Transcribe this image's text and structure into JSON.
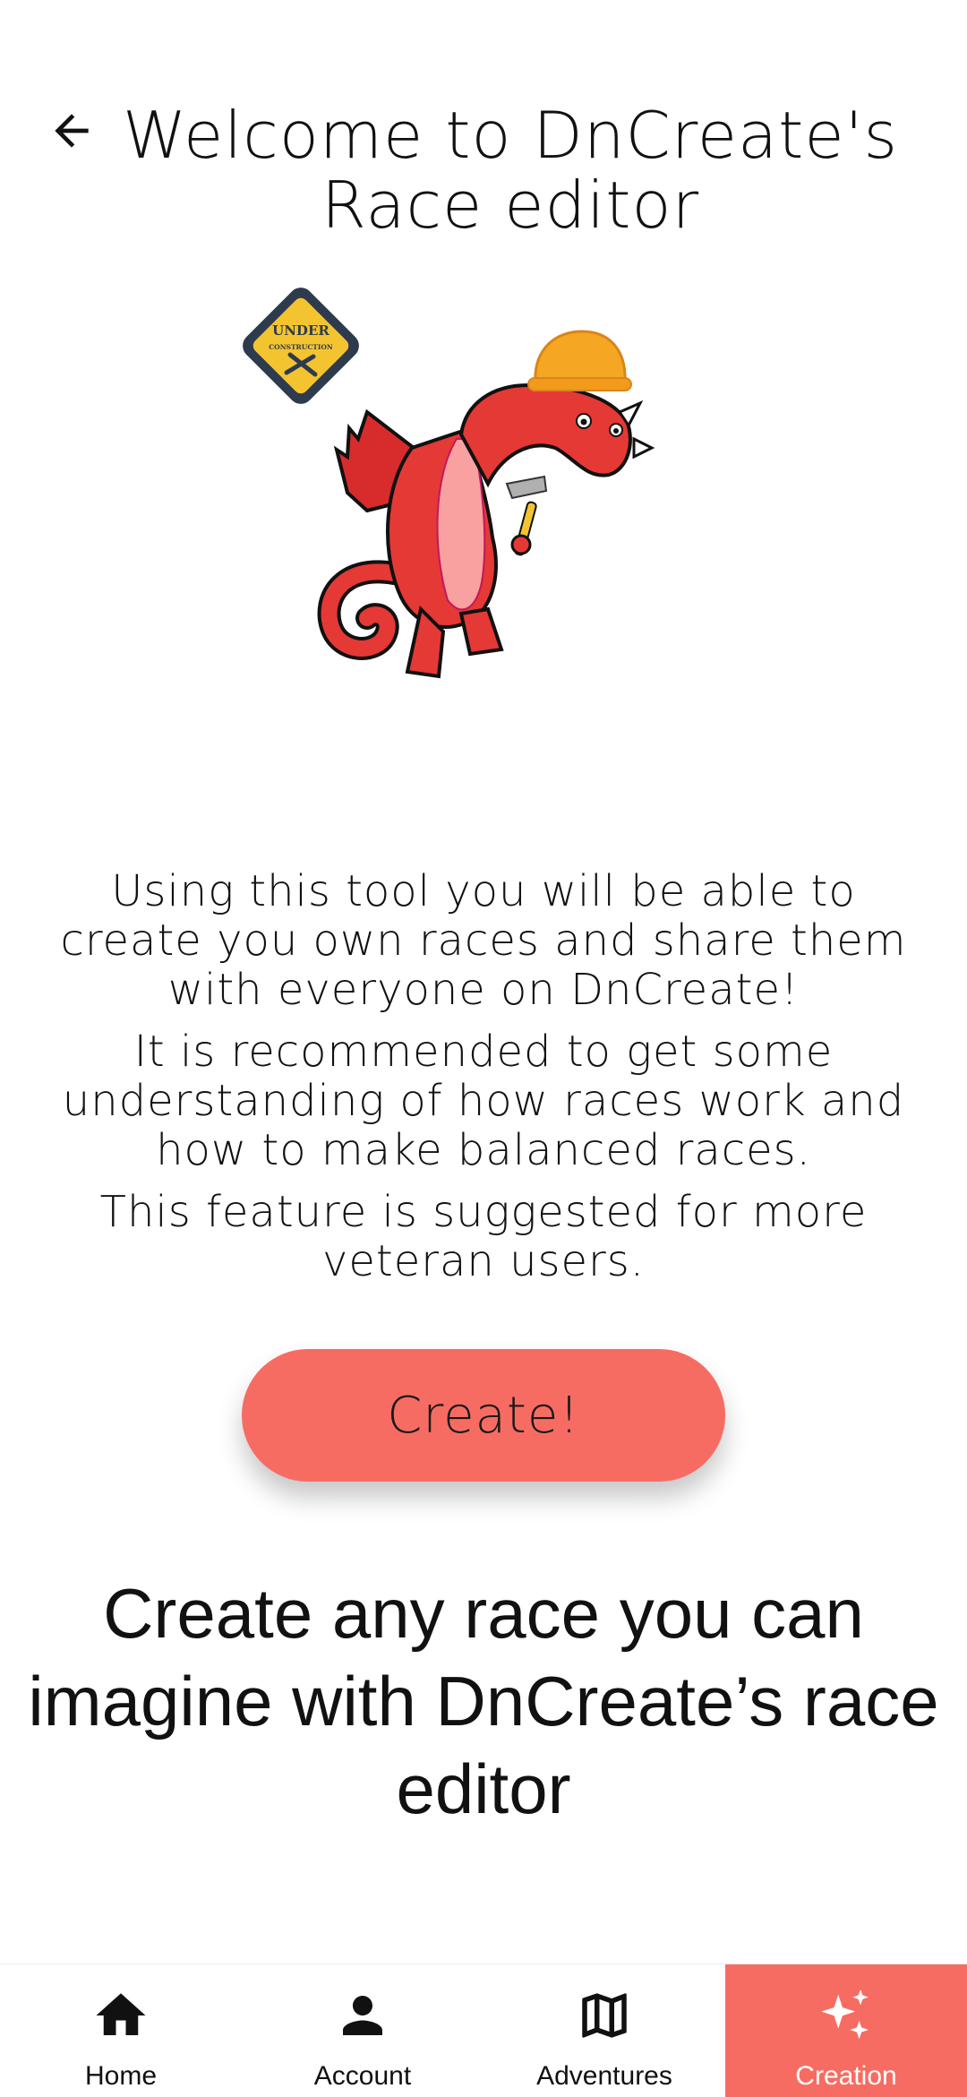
{
  "header": {
    "title": "Welcome to DnCreate's Race editor",
    "back_icon": "arrow-left-icon"
  },
  "hero": {
    "sign_text_line1": "UNDER",
    "sign_text_line2": "CONSTRUCTION"
  },
  "description": {
    "p1": "Using this tool you will be able to create you own races and share them with everyone on DnCreate!",
    "p2": "It is recommended to get some understanding of how races work and how to make balanced races.",
    "p3": "This feature is suggested for more veteran users."
  },
  "create_button": {
    "label": "Create!"
  },
  "tagline": "Create any race you can imagine with DnCreate’s race editor",
  "bottom_nav": {
    "items": [
      {
        "label": "Home",
        "icon": "home-icon"
      },
      {
        "label": "Account",
        "icon": "person-icon"
      },
      {
        "label": "Adventures",
        "icon": "map-icon"
      },
      {
        "label": "Creation",
        "icon": "sparkle-icon",
        "active": true
      }
    ]
  },
  "colors": {
    "accent": "#f76c62",
    "dragon": "#e53935",
    "helmet": "#f5a623",
    "sign": "#f4c430"
  }
}
